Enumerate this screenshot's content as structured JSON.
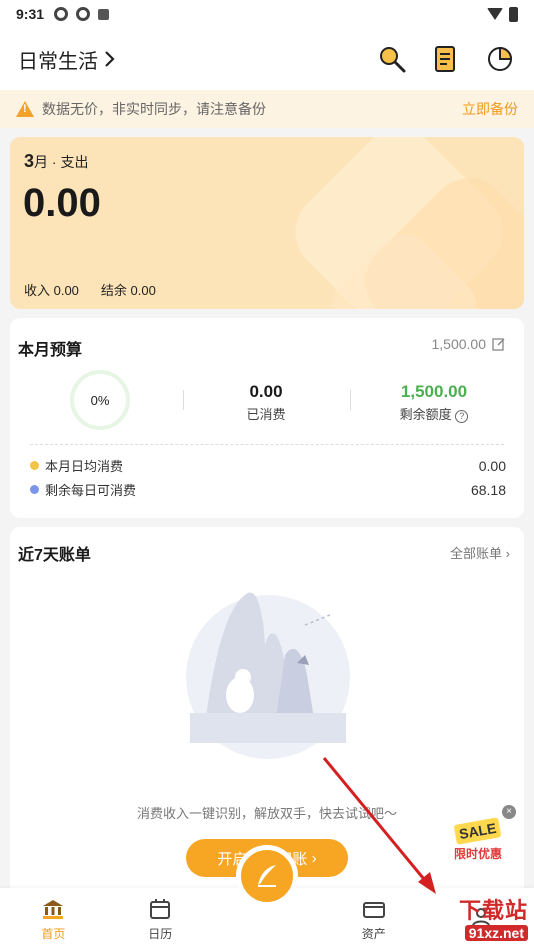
{
  "status": {
    "time": "9:31"
  },
  "header": {
    "book_title": "日常生活"
  },
  "warning": {
    "text": "数据无价，非实时同步，请注意备份",
    "action": "立即备份"
  },
  "summary": {
    "month_num": "3",
    "month_suffix": "月 · 支出",
    "amount": "0.00",
    "income_label": "收入 0.00",
    "balance_label": "结余 0.00"
  },
  "budget": {
    "title": "本月预算",
    "total": "1,500.00",
    "ring_percent": "0%",
    "spent_value": "0.00",
    "spent_label": "已消费",
    "remain_value": "1,500.00",
    "remain_label": "剩余额度",
    "rows": [
      {
        "label": "本月日均消费",
        "value": "0.00",
        "dot": "#f3c44a"
      },
      {
        "label": "剩余每日可消费",
        "value": "68.18",
        "dot": "#7b95e8"
      }
    ]
  },
  "bills": {
    "title": "近7天账单",
    "link": "全部账单",
    "empty_text": "消费收入一键识别，解放双手，快去试试吧～",
    "button": "开启自动识账"
  },
  "promo": {
    "tag": "SALE",
    "label": "限时优惠"
  },
  "tabs": [
    {
      "label": "首页",
      "icon": "bank-icon"
    },
    {
      "label": "日历",
      "icon": "calendar-icon"
    },
    {
      "label": "",
      "icon": "quill-icon"
    },
    {
      "label": "资产",
      "icon": "wallet-icon"
    },
    {
      "label": "",
      "icon": "user-icon"
    }
  ],
  "watermark": {
    "line1": "下载站",
    "line2": "91xz.net"
  },
  "colors": {
    "accent": "#f6a623",
    "green": "#4caf50",
    "warn_bg": "#fdf3e3"
  }
}
